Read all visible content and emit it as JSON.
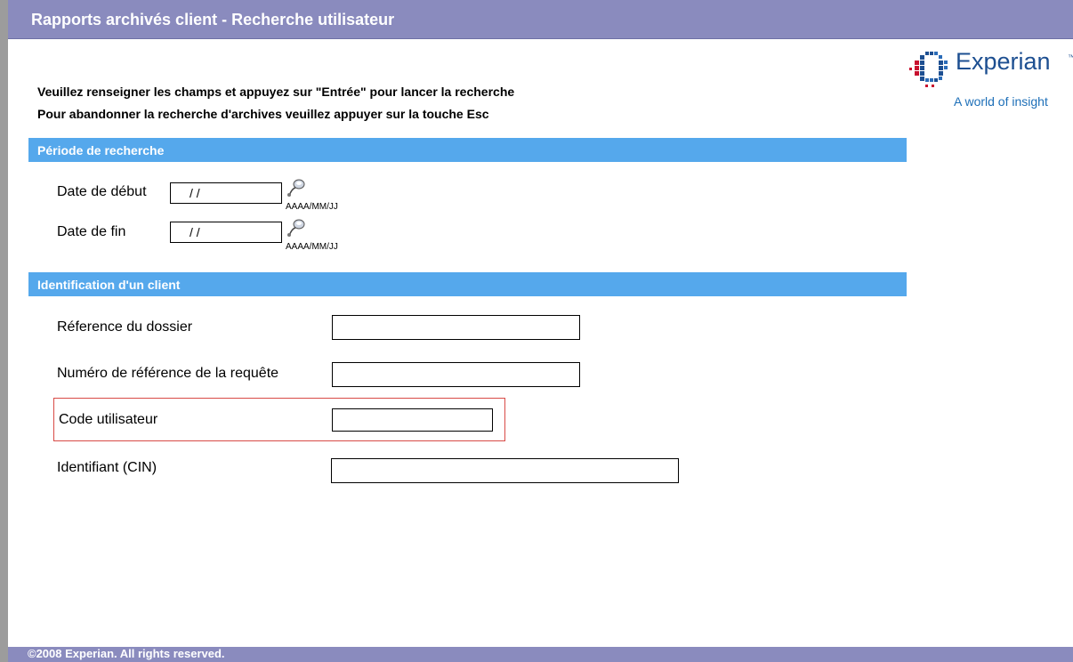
{
  "window": {
    "title": "Rapports archivés client - Recherche utilisateur"
  },
  "logo": {
    "brand": "Experian",
    "trademark": "™",
    "tagline": "A world of insight"
  },
  "instructions": {
    "line1": "Veuillez renseigner les champs et appuyez sur \"Entrée\" pour lancer la recherche",
    "line2": "Pour abandonner la recherche d'archives veuillez appuyer sur la touche Esc"
  },
  "period_section": {
    "title": "Période de recherche",
    "start": {
      "label": "Date de début",
      "value": "/ /",
      "format": "AAAA/MM/JJ",
      "icon": "calendar-icon"
    },
    "end": {
      "label": "Date de fin",
      "value": "/ /",
      "format": "AAAA/MM/JJ",
      "icon": "calendar-icon"
    }
  },
  "client_section": {
    "title": "Identification d'un client",
    "fields": {
      "dossier": {
        "label": "Réference du dossier",
        "value": ""
      },
      "requete": {
        "label": "Numéro de référence de la requête",
        "value": ""
      },
      "user_code": {
        "label": "Code utilisateur",
        "value": ""
      },
      "cin": {
        "label": "Identifiant (CIN)",
        "value": ""
      }
    }
  },
  "footer": {
    "copyright": "©2008 Experian. All rights reserved."
  },
  "colors": {
    "title_bar": "#8a8bbe",
    "section_header": "#55a8ec",
    "highlight": "#d84a46",
    "brand": "#1d4f91"
  }
}
